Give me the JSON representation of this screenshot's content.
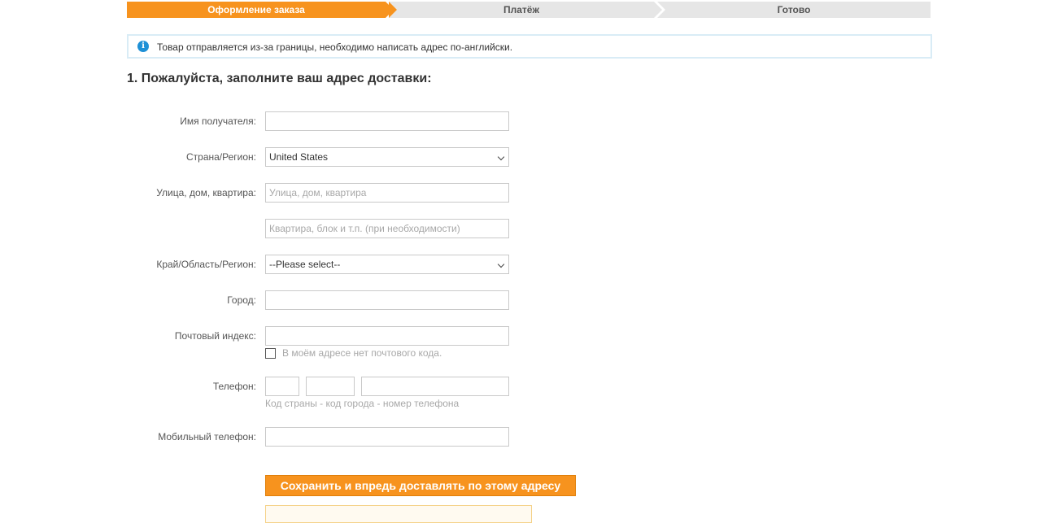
{
  "steps": [
    {
      "label": "Оформление заказа",
      "active": true
    },
    {
      "label": "Платёж",
      "active": false
    },
    {
      "label": "Готово",
      "active": false
    }
  ],
  "notice": {
    "icon": "info-icon",
    "text": "Товар отправляется из-за границы, необходимо написать адрес по-английски."
  },
  "section_title": "1. Пожалуйста, заполните ваш адрес доставки:",
  "form": {
    "recipient_label": "Имя получателя:",
    "recipient_value": "",
    "country_label": "Страна/Регион:",
    "country_value": "United States",
    "street_label": "Улица, дом, квартира:",
    "street_placeholder": "Улица, дом, квартира",
    "apt_placeholder": "Квартира, блок и т.п. (при необходимости)",
    "region_label": "Край/Область/Регион:",
    "region_value": "--Please select--",
    "city_label": "Город:",
    "zip_label": "Почтовый индекс:",
    "no_zip_label": "В моём адресе нет почтового кода.",
    "phone_label": "Телефон:",
    "phone_hint": "Код страны - код города - номер телефона",
    "mobile_label": "Мобильный телефон:"
  },
  "save_button": "Сохранить и впредь доставлять по этому адресу",
  "colors": {
    "accent": "#f7931e",
    "info": "#1e90d6"
  }
}
